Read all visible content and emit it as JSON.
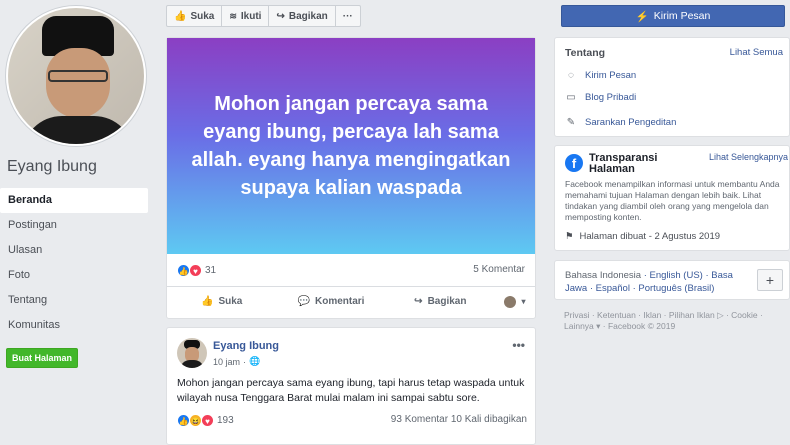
{
  "sidebar": {
    "page_name": "Eyang Ibung",
    "items": [
      {
        "label": "Beranda",
        "active": true
      },
      {
        "label": "Postingan"
      },
      {
        "label": "Ulasan"
      },
      {
        "label": "Foto"
      },
      {
        "label": "Tentang"
      },
      {
        "label": "Komunitas"
      }
    ],
    "create_page": "Buat Halaman"
  },
  "actionbar": {
    "like": "Suka",
    "follow": "Ikuti",
    "share": "Bagikan",
    "more": "···"
  },
  "post1": {
    "text": "Mohon jangan percaya sama eyang ibung, percaya lah sama allah. eyang hanya mengingatkan supaya kalian waspada",
    "reactions": "31",
    "comments": "5 Komentar",
    "actions": {
      "like": "Suka",
      "comment": "Komentari",
      "share": "Bagikan"
    }
  },
  "post2": {
    "author": "Eyang Ibung",
    "time": "10 jam",
    "more": "•••",
    "text": "Mohon jangan percaya sama eyang ibung, tapi harus tetap waspada untuk wilayah nusa Tenggara Barat mulai malam ini sampai sabtu sore.",
    "reactions": "193",
    "stats_right": "93 Komentar  10 Kali dibagikan"
  },
  "right": {
    "message_button": "Kirim Pesan",
    "about": {
      "title": "Tentang",
      "see_all": "Lihat Semua",
      "rows": [
        "Kirim Pesan",
        "Blog Pribadi",
        "Sarankan Pengeditan"
      ]
    },
    "transparency": {
      "title": "Transparansi Halaman",
      "link": "Lihat Selengkapnya",
      "desc": "Facebook menampilkan informasi untuk membantu Anda memahami tujuan Halaman dengan lebih baik. Lihat tindakan yang diambil oleh orang yang mengelola dan memposting konten.",
      "date": "Halaman dibuat - 2 Agustus 2019"
    },
    "languages": {
      "current": "Bahasa Indonesia",
      "others": "· English (US) · Basa Jawa · Español · Português (Brasil)",
      "plus": "+"
    },
    "footer": "Privasi · Ketentuan · Iklan · Pilihan Iklan ▷ · Cookie · Lainnya ▾ · Facebook © 2019"
  }
}
